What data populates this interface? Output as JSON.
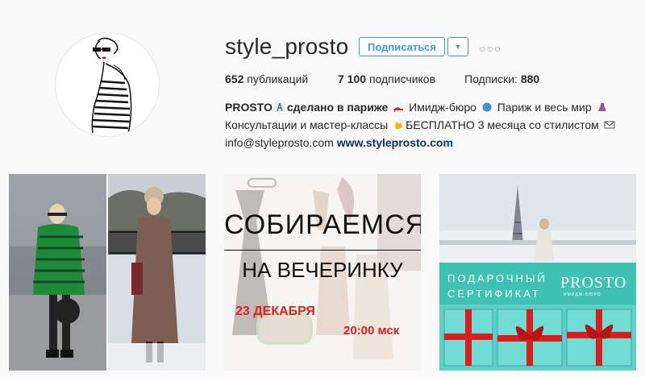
{
  "profile": {
    "username": "style_prosto",
    "follow_label": "Подписаться",
    "dropdown_glyph": "▼",
    "more_glyph": "○○○",
    "posts_count": "652",
    "posts_label": "публикаций",
    "followers_count": "7 100",
    "followers_label": "подписчиков",
    "following_label": "Подписки:",
    "following_count": "880"
  },
  "bio": {
    "name": "PROSTO",
    "tagline": "сделано в париже",
    "text1": "Имидж-бюро",
    "text2": "Париж и весь мир",
    "line2a": "Консультации и мастер-классы",
    "line2b": "БЕСПЛАТНО 3 месяца со стилистом",
    "email": "info@styleprosto.com",
    "website": "www.styleprosto.com"
  },
  "posts": {
    "post2": {
      "title1": "СОБИРАЕМСЯ",
      "title2": "НА ВЕЧЕРИНКУ",
      "date": "23 ДЕКАБРЯ",
      "time": "20:00 мск"
    },
    "post3": {
      "line1": "ПОДАРОЧНЫЙ",
      "line2": "СЕРТИФИКАТ",
      "brand": "PROSTO",
      "brand_sub": "ИМИДЖ-БЮРО"
    }
  },
  "colors": {
    "accent": "#3897f0",
    "link": "#003569",
    "teal": "#3fc2b4",
    "red": "#e0201f"
  }
}
